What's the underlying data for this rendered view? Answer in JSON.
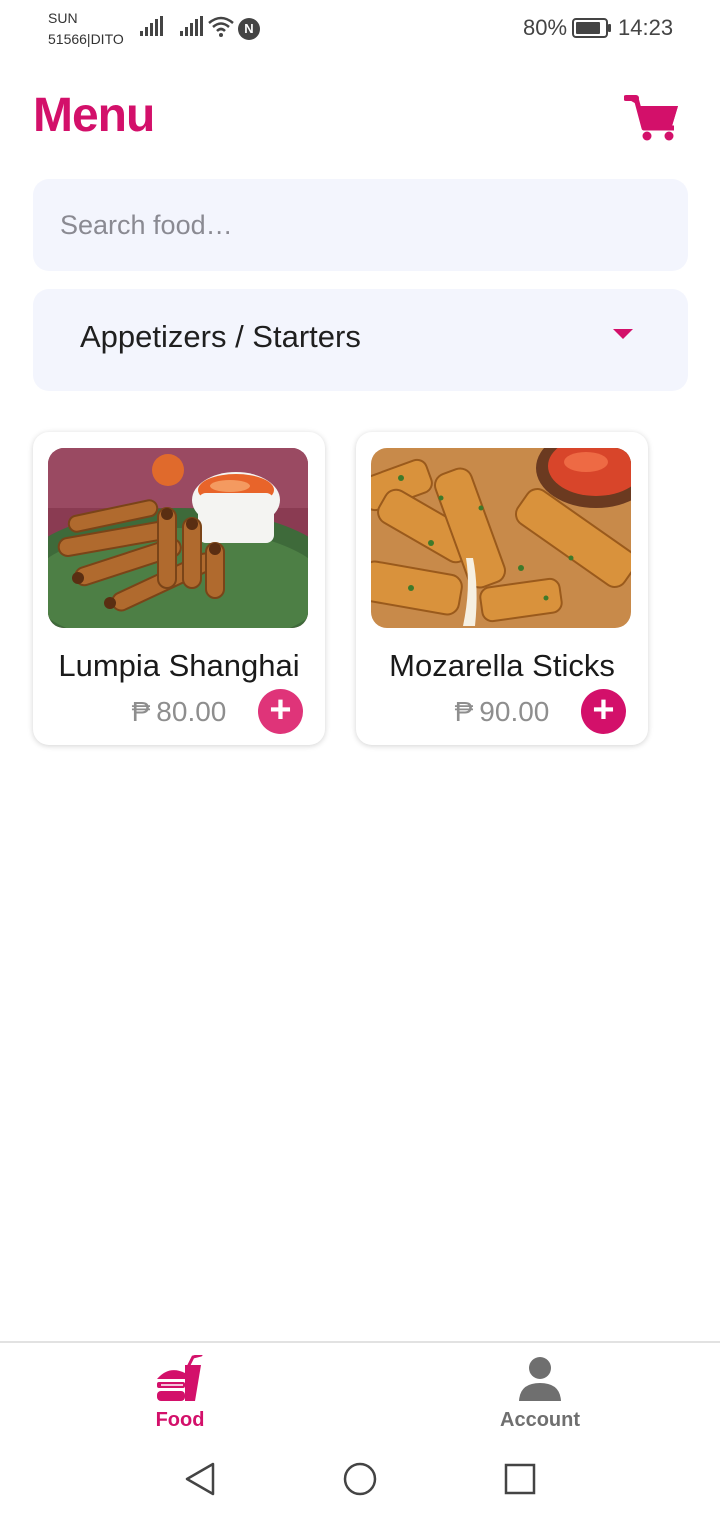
{
  "status_bar": {
    "carrier_line1": "SUN",
    "carrier_line2": "51566|DITO",
    "nfc_letter": "N",
    "battery": "80%",
    "time": "14:23"
  },
  "header": {
    "title": "Menu",
    "cart_icon": "shopping-cart-icon"
  },
  "search": {
    "placeholder": "Search food…",
    "value": ""
  },
  "category_select": {
    "selected": "Appetizers / Starters",
    "icon": "caret-down-icon"
  },
  "foods": [
    {
      "name": "Lumpia Shanghai",
      "currency": "₱",
      "price": "80.00",
      "add_label": "+"
    },
    {
      "name": "Mozarella Sticks",
      "currency": "₱",
      "price": "90.00",
      "add_label": "+"
    }
  ],
  "bottom_nav": {
    "items": [
      {
        "label": "Food",
        "icon": "food-icon",
        "active": true
      },
      {
        "label": "Account",
        "icon": "person-icon",
        "active": false
      }
    ]
  },
  "system_nav": {
    "back": "back-triangle-icon",
    "home": "home-circle-icon",
    "recents": "recents-square-icon"
  },
  "colors": {
    "accent": "#d3106a",
    "field_bg": "#f3f5fd",
    "muted_text": "#8e8e8e"
  }
}
